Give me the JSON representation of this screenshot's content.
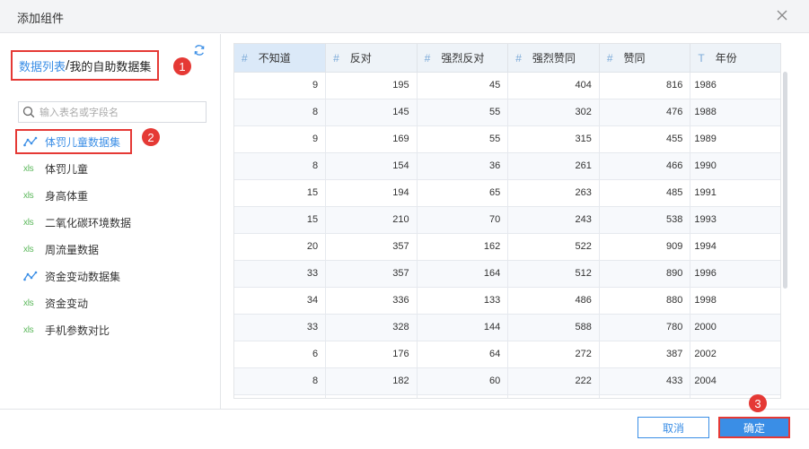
{
  "dialog": {
    "title": "添加组件"
  },
  "breadcrumb": {
    "root": "数据列表",
    "separator": "/",
    "current": "我的自助数据集"
  },
  "annotations": {
    "b1": "1",
    "b2": "2",
    "b3": "3"
  },
  "search": {
    "placeholder": "输入表名或字段名"
  },
  "datasets": [
    {
      "label": "体罚儿童数据集",
      "icon": "self-service-dataset-icon",
      "active": true
    },
    {
      "label": "体罚儿童",
      "icon": "xls-icon"
    },
    {
      "label": "身高体重",
      "icon": "xls-icon"
    },
    {
      "label": "二氧化碳环境数据",
      "icon": "xls-icon"
    },
    {
      "label": "周流量数据",
      "icon": "xls-icon"
    },
    {
      "label": "资金变动数据集",
      "icon": "self-service-dataset-icon"
    },
    {
      "label": "资金变动",
      "icon": "xls-icon"
    },
    {
      "label": "手机参数对比",
      "icon": "xls-icon"
    }
  ],
  "xls_icon_text": "xls",
  "table": {
    "columns": [
      {
        "type": "#",
        "name": "不知道"
      },
      {
        "type": "#",
        "name": "反对"
      },
      {
        "type": "#",
        "name": "强烈反对"
      },
      {
        "type": "#",
        "name": "强烈赞同"
      },
      {
        "type": "#",
        "name": "赞同"
      },
      {
        "type": "T",
        "name": "年份"
      }
    ],
    "rows": [
      [
        "9",
        "195",
        "45",
        "404",
        "816",
        "1986"
      ],
      [
        "8",
        "145",
        "55",
        "302",
        "476",
        "1988"
      ],
      [
        "9",
        "169",
        "55",
        "315",
        "455",
        "1989"
      ],
      [
        "8",
        "154",
        "36",
        "261",
        "466",
        "1990"
      ],
      [
        "15",
        "194",
        "65",
        "263",
        "485",
        "1991"
      ],
      [
        "15",
        "210",
        "70",
        "243",
        "538",
        "1993"
      ],
      [
        "20",
        "357",
        "162",
        "522",
        "909",
        "1994"
      ],
      [
        "33",
        "357",
        "164",
        "512",
        "890",
        "1996"
      ],
      [
        "34",
        "336",
        "133",
        "486",
        "880",
        "1998"
      ],
      [
        "33",
        "328",
        "144",
        "588",
        "780",
        "2000"
      ],
      [
        "6",
        "176",
        "64",
        "272",
        "387",
        "2002"
      ],
      [
        "8",
        "182",
        "60",
        "222",
        "433",
        "2004"
      ],
      [
        "",
        "",
        "",
        "",
        "",
        ""
      ]
    ]
  },
  "footer": {
    "cancel_label": "取消",
    "ok_label": "确定"
  },
  "colors": {
    "accent": "#3a8ee6",
    "annotation": "#e53935",
    "xls": "#5cb85c"
  }
}
